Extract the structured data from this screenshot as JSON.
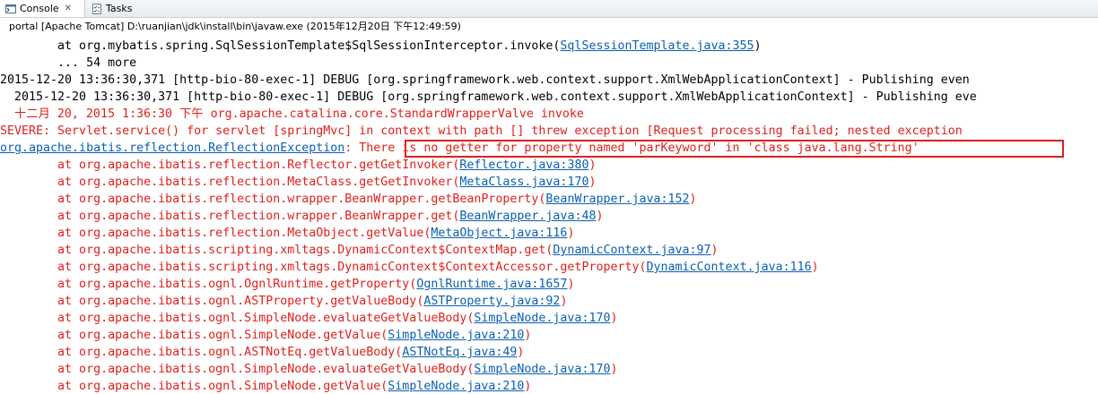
{
  "tabs": [
    {
      "label": "Console",
      "icon": "console-icon",
      "active": true,
      "close": "✕"
    },
    {
      "label": "Tasks",
      "icon": "tasks-icon",
      "active": false
    }
  ],
  "status": "portal [Apache Tomcat] D:\\ruanjian\\jdk\\install\\bin\\javaw.exe (2015年12月20日 下午12:49:59)",
  "colors": {
    "error": "#e0201c",
    "link": "#0a5fb4",
    "normal": "#000000",
    "highlight_border": "#e0201c"
  },
  "lines": [
    {
      "parts": [
        {
          "t": "        at org.mybatis.spring.SqlSessionTemplate$SqlSessionInterceptor.invoke(",
          "c": "blk"
        },
        {
          "t": "SqlSessionTemplate.java:355",
          "c": "lnk"
        },
        {
          "t": ")",
          "c": "blk"
        }
      ]
    },
    {
      "parts": [
        {
          "t": "        ... 54 more",
          "c": "blk"
        }
      ]
    },
    {
      "parts": [
        {
          "t": "2015-12-20 13:36:30,371 [http-bio-80-exec-1] DEBUG [org.springframework.web.context.support.XmlWebApplicationContext] - Publishing even",
          "c": "blk"
        }
      ]
    },
    {
      "parts": [
        {
          "t": "  2015-12-20 13:36:30,371 [http-bio-80-exec-1] DEBUG [org.springframework.web.context.support.XmlWebApplicationContext] - Publishing eve",
          "c": "blk"
        }
      ]
    },
    {
      "parts": [
        {
          "t": "  十二月 20, 2015 1:36:30 下午 org.apache.catalina.core.StandardWrapperValve invoke",
          "c": "red"
        }
      ]
    },
    {
      "parts": [
        {
          "t": "SEVERE: Servlet.service() for servlet [springMvc] in context with path [] threw exception [Request processing failed; nested exception",
          "c": "red"
        }
      ]
    },
    {
      "parts": [
        {
          "t": "org.apache.ibatis.reflection.ReflectionException",
          "c": "lnk"
        },
        {
          "t": ": There is no getter for property named 'parKeyword' in 'class java.lang.String'",
          "c": "red"
        }
      ]
    },
    {
      "parts": [
        {
          "t": "        at org.apache.ibatis.reflection.Reflector.getGetInvoker(",
          "c": "red"
        },
        {
          "t": "Reflector.java:380",
          "c": "lnk"
        },
        {
          "t": ")",
          "c": "red"
        }
      ]
    },
    {
      "parts": [
        {
          "t": "        at org.apache.ibatis.reflection.MetaClass.getGetInvoker(",
          "c": "red"
        },
        {
          "t": "MetaClass.java:170",
          "c": "lnk"
        },
        {
          "t": ")",
          "c": "red"
        }
      ]
    },
    {
      "parts": [
        {
          "t": "        at org.apache.ibatis.reflection.wrapper.BeanWrapper.getBeanProperty(",
          "c": "red"
        },
        {
          "t": "BeanWrapper.java:152",
          "c": "lnk"
        },
        {
          "t": ")",
          "c": "red"
        }
      ]
    },
    {
      "parts": [
        {
          "t": "        at org.apache.ibatis.reflection.wrapper.BeanWrapper.get(",
          "c": "red"
        },
        {
          "t": "BeanWrapper.java:48",
          "c": "lnk"
        },
        {
          "t": ")",
          "c": "red"
        }
      ]
    },
    {
      "parts": [
        {
          "t": "        at org.apache.ibatis.reflection.MetaObject.getValue(",
          "c": "red"
        },
        {
          "t": "MetaObject.java:116",
          "c": "lnk"
        },
        {
          "t": ")",
          "c": "red"
        }
      ]
    },
    {
      "parts": [
        {
          "t": "        at org.apache.ibatis.scripting.xmltags.DynamicContext$ContextMap.get(",
          "c": "red"
        },
        {
          "t": "DynamicContext.java:97",
          "c": "lnk"
        },
        {
          "t": ")",
          "c": "red"
        }
      ]
    },
    {
      "parts": [
        {
          "t": "        at org.apache.ibatis.scripting.xmltags.DynamicContext$ContextAccessor.getProperty(",
          "c": "red"
        },
        {
          "t": "DynamicContext.java:116",
          "c": "lnk"
        },
        {
          "t": ")",
          "c": "red"
        }
      ]
    },
    {
      "parts": [
        {
          "t": "        at org.apache.ibatis.ognl.OgnlRuntime.getProperty(",
          "c": "red"
        },
        {
          "t": "OgnlRuntime.java:1657",
          "c": "lnk"
        },
        {
          "t": ")",
          "c": "red"
        }
      ]
    },
    {
      "parts": [
        {
          "t": "        at org.apache.ibatis.ognl.ASTProperty.getValueBody(",
          "c": "red"
        },
        {
          "t": "ASTProperty.java:92",
          "c": "lnk"
        },
        {
          "t": ")",
          "c": "red"
        }
      ]
    },
    {
      "parts": [
        {
          "t": "        at org.apache.ibatis.ognl.SimpleNode.evaluateGetValueBody(",
          "c": "red"
        },
        {
          "t": "SimpleNode.java:170",
          "c": "lnk"
        },
        {
          "t": ")",
          "c": "red"
        }
      ]
    },
    {
      "parts": [
        {
          "t": "        at org.apache.ibatis.ognl.SimpleNode.getValue(",
          "c": "red"
        },
        {
          "t": "SimpleNode.java:210",
          "c": "lnk"
        },
        {
          "t": ")",
          "c": "red"
        }
      ]
    },
    {
      "parts": [
        {
          "t": "        at org.apache.ibatis.ognl.ASTNotEq.getValueBody(",
          "c": "red"
        },
        {
          "t": "ASTNotEq.java:49",
          "c": "lnk"
        },
        {
          "t": ")",
          "c": "red"
        }
      ]
    },
    {
      "parts": [
        {
          "t": "        at org.apache.ibatis.ognl.SimpleNode.evaluateGetValueBody(",
          "c": "red"
        },
        {
          "t": "SimpleNode.java:170",
          "c": "lnk"
        },
        {
          "t": ")",
          "c": "red"
        }
      ]
    },
    {
      "parts": [
        {
          "t": "        at org.apache.ibatis.ognl.SimpleNode.getValue(",
          "c": "red"
        },
        {
          "t": "SimpleNode.java:210",
          "c": "lnk"
        },
        {
          "t": ")",
          "c": "red"
        }
      ]
    }
  ]
}
